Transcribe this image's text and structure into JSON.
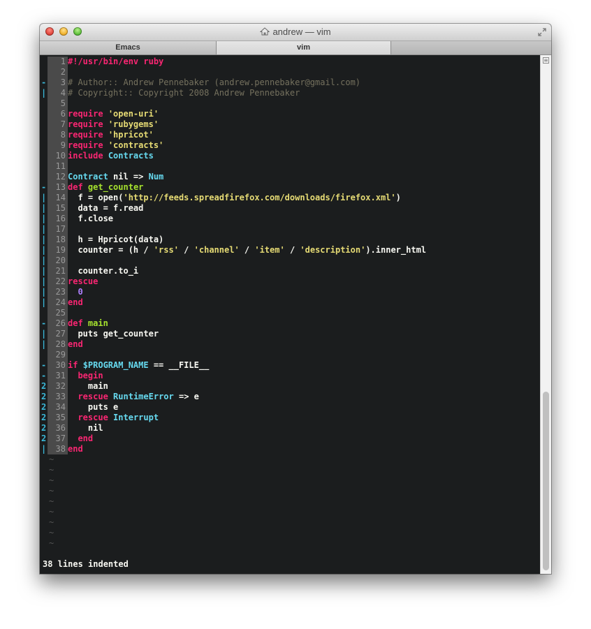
{
  "window": {
    "title": "andrew — vim",
    "tabs": [
      "Emacs",
      "vim"
    ]
  },
  "colors": {
    "background": "#1b1d1e",
    "keyword": "#f92672",
    "string": "#e6db74",
    "constant": "#66d9ef",
    "function": "#a6e22e",
    "number": "#ae81ff",
    "comment": "#75715e",
    "fold": "#3ab8d8"
  },
  "lines": [
    {
      "n": "1",
      "f": "",
      "t": [
        [
          "#!/usr/bin/env ruby",
          "keyword"
        ]
      ]
    },
    {
      "n": "2",
      "f": "",
      "t": []
    },
    {
      "n": "3",
      "f": "-",
      "t": [
        [
          "# Author:: Andrew Pennebaker (andrew.pennebaker@gmail.com)",
          "comment"
        ]
      ]
    },
    {
      "n": "4",
      "f": "|",
      "t": [
        [
          "# Copyright:: Copyright 2008 Andrew Pennebaker",
          "comment"
        ]
      ]
    },
    {
      "n": "5",
      "f": "",
      "t": []
    },
    {
      "n": "6",
      "f": "",
      "t": [
        [
          "require",
          "keyword"
        ],
        [
          " ",
          ""
        ],
        [
          "'open-uri'",
          "string"
        ]
      ]
    },
    {
      "n": "7",
      "f": "",
      "t": [
        [
          "require",
          "keyword"
        ],
        [
          " ",
          ""
        ],
        [
          "'rubygems'",
          "string"
        ]
      ]
    },
    {
      "n": "8",
      "f": "",
      "t": [
        [
          "require",
          "keyword"
        ],
        [
          " ",
          ""
        ],
        [
          "'hpricot'",
          "string"
        ]
      ]
    },
    {
      "n": "9",
      "f": "",
      "t": [
        [
          "require",
          "keyword"
        ],
        [
          " ",
          ""
        ],
        [
          "'contracts'",
          "string"
        ]
      ]
    },
    {
      "n": "10",
      "f": "",
      "t": [
        [
          "include",
          "keyword"
        ],
        [
          " ",
          ""
        ],
        [
          "Contracts",
          "constant"
        ]
      ]
    },
    {
      "n": "11",
      "f": "",
      "t": []
    },
    {
      "n": "12",
      "f": "",
      "t": [
        [
          "Contract",
          "constant"
        ],
        [
          " nil => ",
          ""
        ],
        [
          "Num",
          "constant"
        ]
      ]
    },
    {
      "n": "13",
      "f": "-",
      "t": [
        [
          "def",
          "keyword"
        ],
        [
          " ",
          ""
        ],
        [
          "get_counter",
          "function"
        ]
      ]
    },
    {
      "n": "14",
      "f": "|",
      "t": [
        [
          "  f = open(",
          ""
        ],
        [
          "'http://feeds.spreadfirefox.com/downloads/firefox.xml'",
          "string"
        ],
        [
          ")",
          ""
        ]
      ]
    },
    {
      "n": "15",
      "f": "|",
      "t": [
        [
          "  data = f.read",
          ""
        ]
      ]
    },
    {
      "n": "16",
      "f": "|",
      "t": [
        [
          "  f.close",
          ""
        ]
      ]
    },
    {
      "n": "17",
      "f": "|",
      "t": []
    },
    {
      "n": "18",
      "f": "|",
      "t": [
        [
          "  h = Hpricot(data)",
          ""
        ]
      ]
    },
    {
      "n": "19",
      "f": "|",
      "t": [
        [
          "  counter = (h / ",
          ""
        ],
        [
          "'rss'",
          "string"
        ],
        [
          " / ",
          ""
        ],
        [
          "'channel'",
          "string"
        ],
        [
          " / ",
          ""
        ],
        [
          "'item'",
          "string"
        ],
        [
          " / ",
          ""
        ],
        [
          "'description'",
          "string"
        ],
        [
          ").inner_html",
          ""
        ]
      ]
    },
    {
      "n": "20",
      "f": "|",
      "t": []
    },
    {
      "n": "21",
      "f": "|",
      "t": [
        [
          "  counter.to_i",
          ""
        ]
      ]
    },
    {
      "n": "22",
      "f": "|",
      "t": [
        [
          "rescue",
          "keyword"
        ]
      ]
    },
    {
      "n": "23",
      "f": "|",
      "t": [
        [
          "  ",
          ""
        ],
        [
          "0",
          "number"
        ]
      ]
    },
    {
      "n": "24",
      "f": "|",
      "t": [
        [
          "end",
          "keyword"
        ]
      ]
    },
    {
      "n": "25",
      "f": "",
      "t": []
    },
    {
      "n": "26",
      "f": "-",
      "t": [
        [
          "def",
          "keyword"
        ],
        [
          " ",
          ""
        ],
        [
          "main",
          "function"
        ]
      ]
    },
    {
      "n": "27",
      "f": "|",
      "t": [
        [
          "  puts get_counter",
          ""
        ]
      ]
    },
    {
      "n": "28",
      "f": "|",
      "t": [
        [
          "end",
          "keyword"
        ]
      ]
    },
    {
      "n": "29",
      "f": "",
      "t": []
    },
    {
      "n": "30",
      "f": "-",
      "t": [
        [
          "if",
          "keyword"
        ],
        [
          " ",
          ""
        ],
        [
          "$PROGRAM_NAME",
          "constant"
        ],
        [
          " == __FILE__",
          ""
        ]
      ]
    },
    {
      "n": "31",
      "f": "-",
      "t": [
        [
          "  ",
          ""
        ],
        [
          "begin",
          "keyword"
        ]
      ]
    },
    {
      "n": "32",
      "f": "2",
      "t": [
        [
          "    main",
          ""
        ]
      ]
    },
    {
      "n": "33",
      "f": "2",
      "t": [
        [
          "  ",
          ""
        ],
        [
          "rescue",
          "keyword"
        ],
        [
          " ",
          ""
        ],
        [
          "RuntimeError",
          "constant"
        ],
        [
          " => e",
          ""
        ]
      ]
    },
    {
      "n": "34",
      "f": "2",
      "t": [
        [
          "    puts e",
          ""
        ]
      ]
    },
    {
      "n": "35",
      "f": "2",
      "t": [
        [
          "  ",
          ""
        ],
        [
          "rescue",
          "keyword"
        ],
        [
          " ",
          ""
        ],
        [
          "Interrupt",
          "constant"
        ]
      ]
    },
    {
      "n": "36",
      "f": "2",
      "t": [
        [
          "    nil",
          ""
        ]
      ]
    },
    {
      "n": "37",
      "f": "2",
      "t": [
        [
          "  ",
          ""
        ],
        [
          "end",
          "keyword"
        ]
      ]
    },
    {
      "n": "38",
      "f": "|",
      "t": [
        [
          "end",
          "keyword"
        ]
      ]
    }
  ],
  "tilde": "~",
  "empty_line_count": 9,
  "status_message": "38 lines indented"
}
